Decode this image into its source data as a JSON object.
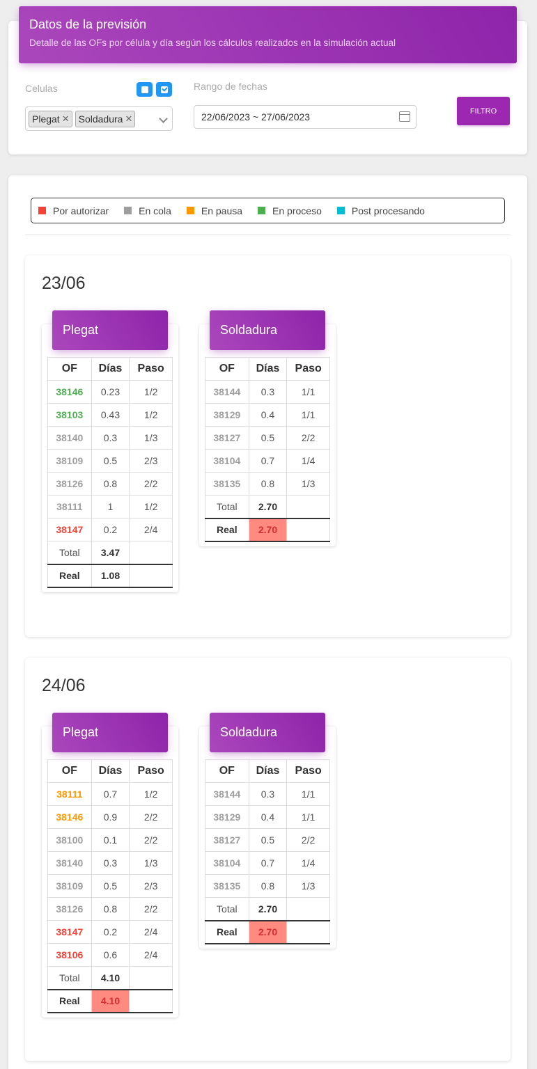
{
  "header": {
    "title": "Datos de la previsión",
    "subtitle": "Detalle de las OFs por célula y día según los cálculos realizados en la simulación actual"
  },
  "filters": {
    "cells_label": "Celulas",
    "selected_cells": [
      "Plegat",
      "Soldadura"
    ],
    "date_label": "Rango de fechas",
    "date_value": "22/06/2023 ~ 27/06/2023",
    "filter_button": "FILTRO"
  },
  "legend": [
    {
      "label": "Por autorizar",
      "color": "#f44336"
    },
    {
      "label": "En cola",
      "color": "#9e9e9e"
    },
    {
      "label": "En pausa",
      "color": "#ff9800"
    },
    {
      "label": "En proceso",
      "color": "#4caf50"
    },
    {
      "label": "Post procesando",
      "color": "#00bcd4"
    }
  ],
  "columns": {
    "of": "OF",
    "dias": "Días",
    "paso": "Paso",
    "total": "Total",
    "real": "Real"
  },
  "days": [
    {
      "date": "23/06",
      "cells": [
        {
          "name": "Plegat",
          "rows": [
            {
              "of": "38146",
              "dias": "0.23",
              "paso": "1/2",
              "status": "En proceso"
            },
            {
              "of": "38103",
              "dias": "0.43",
              "paso": "1/2",
              "status": "En proceso"
            },
            {
              "of": "38140",
              "dias": "0.3",
              "paso": "1/3",
              "status": "En cola"
            },
            {
              "of": "38109",
              "dias": "0.5",
              "paso": "2/3",
              "status": "En cola"
            },
            {
              "of": "38126",
              "dias": "0.8",
              "paso": "2/2",
              "status": "En cola"
            },
            {
              "of": "38111",
              "dias": "1",
              "paso": "1/2",
              "status": "En cola"
            },
            {
              "of": "38147",
              "dias": "0.2",
              "paso": "2/4",
              "status": "Por autorizar"
            }
          ],
          "total": "3.47",
          "real": "1.08",
          "real_highlight": false
        },
        {
          "name": "Soldadura",
          "rows": [
            {
              "of": "38144",
              "dias": "0.3",
              "paso": "1/1",
              "status": "En cola"
            },
            {
              "of": "38129",
              "dias": "0.4",
              "paso": "1/1",
              "status": "En cola"
            },
            {
              "of": "38127",
              "dias": "0.5",
              "paso": "2/2",
              "status": "En cola"
            },
            {
              "of": "38104",
              "dias": "0.7",
              "paso": "1/4",
              "status": "En cola"
            },
            {
              "of": "38135",
              "dias": "0.8",
              "paso": "1/3",
              "status": "En cola"
            }
          ],
          "total": "2.70",
          "real": "2.70",
          "real_highlight": true
        }
      ]
    },
    {
      "date": "24/06",
      "cells": [
        {
          "name": "Plegat",
          "rows": [
            {
              "of": "38111",
              "dias": "0.7",
              "paso": "1/2",
              "status": "En pausa"
            },
            {
              "of": "38146",
              "dias": "0.9",
              "paso": "2/2",
              "status": "En pausa"
            },
            {
              "of": "38100",
              "dias": "0.1",
              "paso": "2/2",
              "status": "En cola"
            },
            {
              "of": "38140",
              "dias": "0.3",
              "paso": "1/3",
              "status": "En cola"
            },
            {
              "of": "38109",
              "dias": "0.5",
              "paso": "2/3",
              "status": "En cola"
            },
            {
              "of": "38126",
              "dias": "0.8",
              "paso": "2/2",
              "status": "En cola"
            },
            {
              "of": "38147",
              "dias": "0.2",
              "paso": "2/4",
              "status": "Por autorizar"
            },
            {
              "of": "38106",
              "dias": "0.6",
              "paso": "2/4",
              "status": "Por autorizar"
            }
          ],
          "total": "4.10",
          "real": "4.10",
          "real_highlight": true
        },
        {
          "name": "Soldadura",
          "rows": [
            {
              "of": "38144",
              "dias": "0.3",
              "paso": "1/1",
              "status": "En cola"
            },
            {
              "of": "38129",
              "dias": "0.4",
              "paso": "1/1",
              "status": "En cola"
            },
            {
              "of": "38127",
              "dias": "0.5",
              "paso": "2/2",
              "status": "En cola"
            },
            {
              "of": "38104",
              "dias": "0.7",
              "paso": "1/4",
              "status": "En cola"
            },
            {
              "of": "38135",
              "dias": "0.8",
              "paso": "1/3",
              "status": "En cola"
            }
          ],
          "total": "2.70",
          "real": "2.70",
          "real_highlight": true
        }
      ]
    }
  ]
}
